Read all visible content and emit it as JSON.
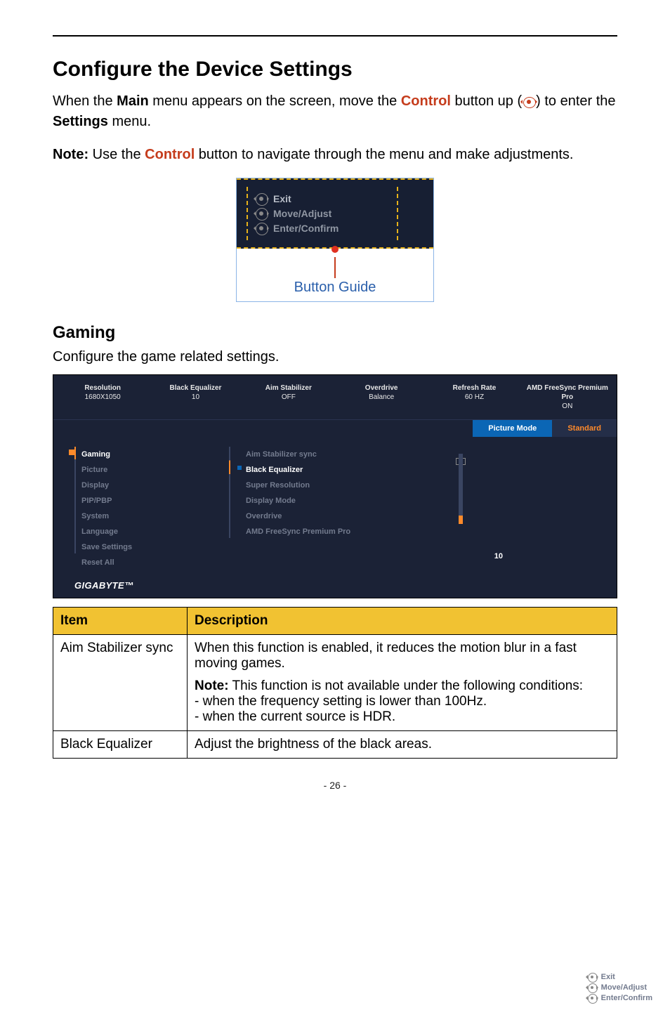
{
  "headings": {
    "h1": "Configure the Device Settings",
    "h2": "Gaming"
  },
  "paragraphs": {
    "p1_pre": "When the ",
    "p1_main": "Main",
    "p1_mid": " menu appears on the screen, move the ",
    "p1_control": "Control",
    "p1_post": " button up (",
    "p1_after_icon": ") to enter the ",
    "p1_settings": "Settings",
    "p1_end": " menu.",
    "note_label": "Note:",
    "note_pre": " Use the ",
    "note_control": "Control",
    "note_post": " button to navigate through the menu and make adjustments.",
    "gaming_sub": "Configure the game related settings."
  },
  "guide": {
    "exit": "Exit",
    "move": "Move/Adjust",
    "enter": "Enter/Confirm",
    "label": "Button Guide"
  },
  "osd": {
    "status": [
      {
        "t": "Resolution",
        "v": "1680X1050"
      },
      {
        "t": "Black Equalizer",
        "v": "10"
      },
      {
        "t": "Aim Stabilizer",
        "v": "OFF"
      },
      {
        "t": "Overdrive",
        "v": "Balance"
      },
      {
        "t": "Refresh Rate",
        "v": "60 HZ"
      },
      {
        "t": "AMD FreeSync Premium Pro",
        "v": "ON"
      }
    ],
    "mode_label": "Picture Mode",
    "mode_value": "Standard",
    "left": [
      "Gaming",
      "Picture",
      "Display",
      "PIP/PBP",
      "System",
      "Language",
      "Save Settings",
      "Reset All"
    ],
    "mid": [
      "Aim Stabilizer sync",
      "Black Equalizer",
      "Super Resolution",
      "Display Mode",
      "Overdrive",
      "AMD FreeSync Premium Pro"
    ],
    "slider_value": "10",
    "brand": "GIGABYTE™",
    "help": {
      "exit": "Exit",
      "move": "Move/Adjust",
      "enter": "Enter/Confirm"
    }
  },
  "table": {
    "h_item": "Item",
    "h_desc": "Description",
    "rows": [
      {
        "item": "Aim Stabilizer sync",
        "desc1": "When this function is enabled, it reduces the motion blur in a fast moving games.",
        "note_label": "Note:",
        "note_text": " This function is not available under the following conditions:",
        "b1": "- when the frequency setting is lower than 100Hz.",
        "b2": "- when the current source is HDR."
      },
      {
        "item": "Black Equalizer",
        "desc1": "Adjust the brightness of the black areas."
      }
    ]
  },
  "page_number": "- 26 -"
}
